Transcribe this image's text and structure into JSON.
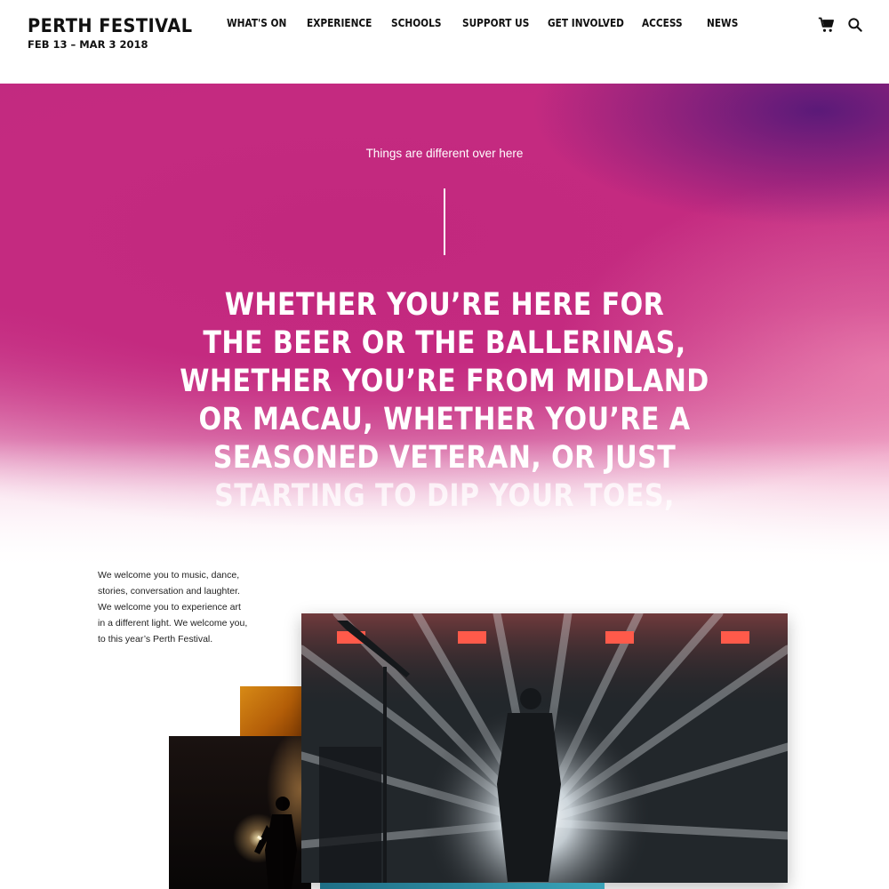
{
  "header": {
    "brand_name": "PERTH FESTIVAL",
    "brand_dates": "FEB 13 – MAR 3 2018",
    "nav": [
      {
        "label": "WHAT'S ON",
        "name": "nav-whats-on"
      },
      {
        "label": "EXPERIENCE",
        "name": "nav-experience"
      },
      {
        "label": "SCHOOLS",
        "name": "nav-schools"
      },
      {
        "label": "SUPPORT US",
        "name": "nav-support-us"
      },
      {
        "label": "GET INVOLVED",
        "name": "nav-get-involved"
      },
      {
        "label": "ACCESS",
        "name": "nav-access"
      },
      {
        "label": "NEWS",
        "name": "nav-news"
      }
    ],
    "icons": [
      "cart-icon",
      "search-icon"
    ]
  },
  "hero": {
    "tagline": "Things are different over here",
    "headline_lines": [
      "WHETHER YOU’RE HERE FOR",
      "THE BEER OR THE BALLERINAS,",
      "WHETHER YOU’RE FROM MIDLAND",
      "OR MACAU, WHETHER YOU’RE A",
      "SEASONED VETERAN, OR JUST",
      "STARTING TO DIP YOUR TOES,"
    ]
  },
  "intro": {
    "text": "We welcome you to music, dance, stories, conversation and laughter. We welcome you to experience art in a different light. We welcome you, to this year’s Perth Festival."
  },
  "colors": {
    "hero_magenta": "#c42a80",
    "hero_purple": "#55197a",
    "text_dark": "#111111"
  }
}
